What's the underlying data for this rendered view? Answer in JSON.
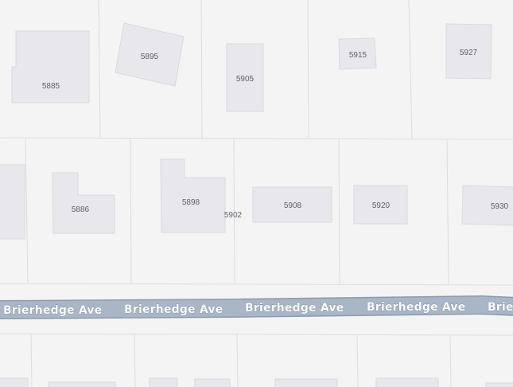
{
  "colors": {
    "background": "#f4f4f4",
    "parcel_fill": "#f5f5f5",
    "parcel_line": "#dcdcde",
    "building_fill": "#e7e7ec",
    "building_edge": "#d9d9df",
    "address_text": "#5f6368",
    "road_fill": "#a8b6c6",
    "road_edge": "#8c9bad",
    "road_text": "#ffffff",
    "road_halo": "#6b7a8c"
  },
  "road": {
    "name": "Brierhedge Ave",
    "labels": [
      "Brierhedge Ave",
      "Brierhedge Ave",
      "Brierhedge Ave",
      "Brierhedge Ave",
      "Brierhedge Ave"
    ]
  },
  "buildings": {
    "b5885": "5885",
    "b5895": "5895",
    "b5905": "5905",
    "b5915": "5915",
    "b5927": "5927",
    "b5886": "5886",
    "b5898": "5898",
    "b5902": "5902",
    "b5908": "5908",
    "b5920": "5920",
    "b5930": "5930"
  }
}
